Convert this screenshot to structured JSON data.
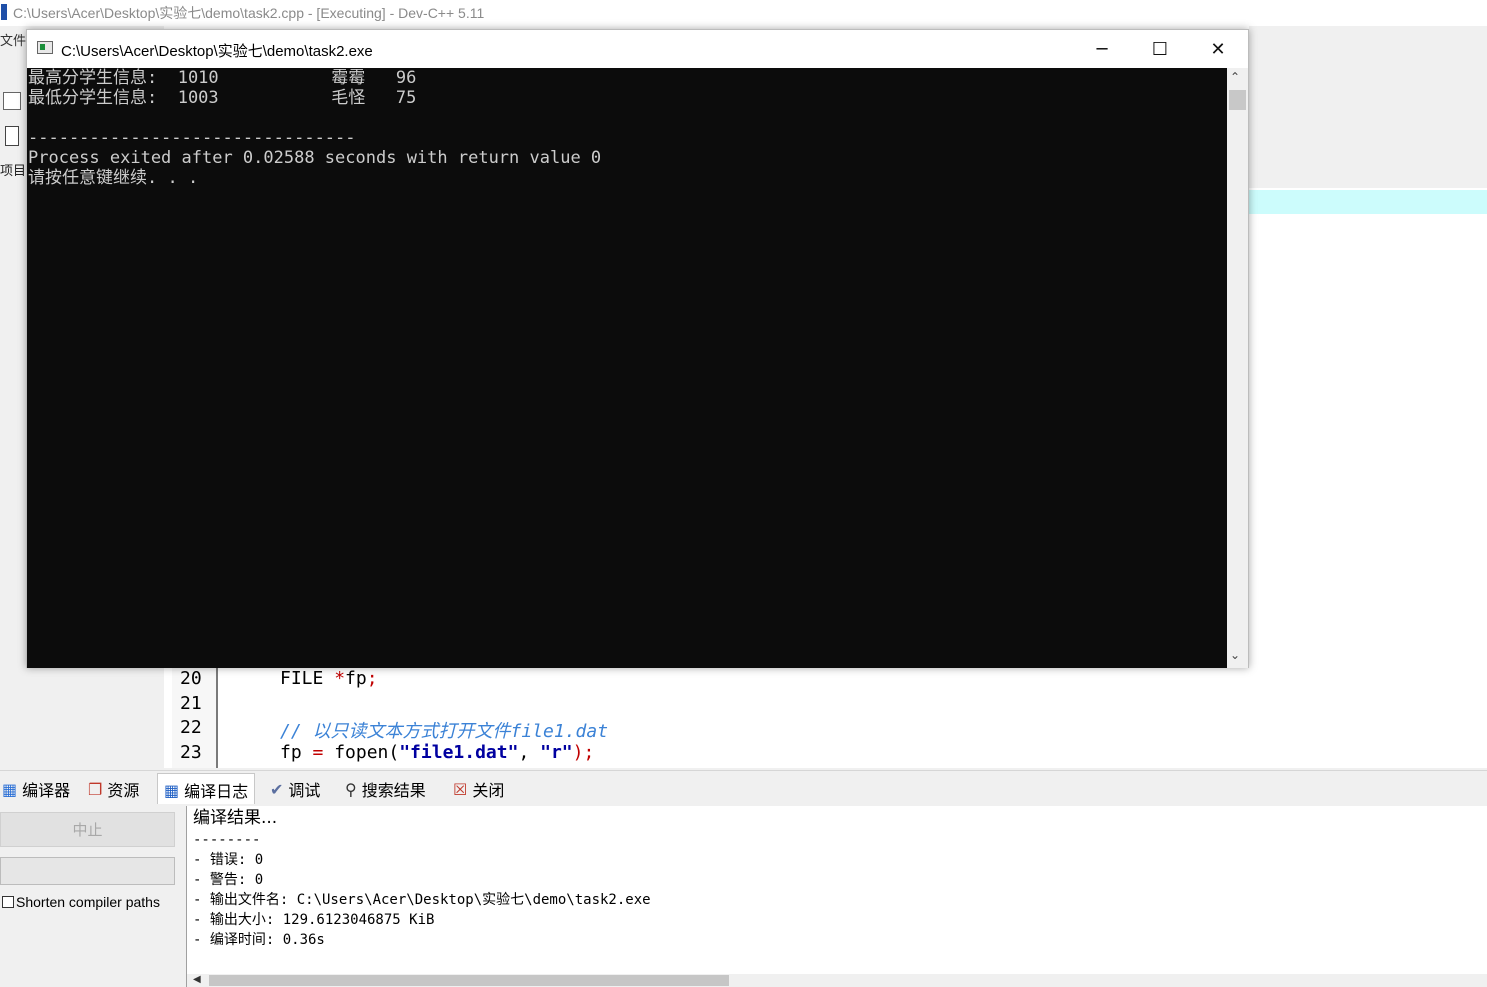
{
  "ide": {
    "title": "C:\\Users\\Acer\\Desktop\\实验七\\demo\\task2.cpp - [Executing] - Dev-C++ 5.11",
    "menu_fragment": "文件",
    "project_tab_fragment": "项目"
  },
  "console": {
    "title": "C:\\Users\\Acer\\Desktop\\实验七\\demo\\task2.exe",
    "controls": {
      "minimize": "─",
      "maximize": "☐",
      "close": "✕"
    },
    "lines": [
      "最高分学生信息:  1010           霉霉   96",
      "最低分学生信息:  1003           毛怪   75",
      "",
      "--------------------------------",
      "Process exited after 0.02588 seconds with return value 0",
      "请按任意键继续. . ."
    ]
  },
  "editor": {
    "lines": [
      {
        "num": "20",
        "pre": "FILE ",
        "op": "*",
        "code": "fp",
        "post": ";"
      },
      {
        "num": "21"
      },
      {
        "num": "22",
        "comment": "// 以只读文本方式打开文件file1.dat"
      },
      {
        "num": "23",
        "pre": "fp ",
        "op": "=",
        "code": " fopen(",
        "str1": "\"file1.dat\"",
        "mid": ", ",
        "str2": "\"r\"",
        "post": ");"
      }
    ]
  },
  "bottom_tabs": [
    {
      "label": "编译器",
      "icon": "grid-icon"
    },
    {
      "label": "资源",
      "icon": "resources-icon"
    },
    {
      "label": "编译日志",
      "icon": "bar-chart-icon"
    },
    {
      "label": "调试",
      "icon": "check-icon"
    },
    {
      "label": "搜索结果",
      "icon": "search-icon"
    },
    {
      "label": "关闭",
      "icon": "close-icon"
    }
  ],
  "compile": {
    "abort_label": "中止",
    "shorten_label": "Shorten compiler paths",
    "log": [
      "编译结果...",
      "--------",
      "- 错误: 0",
      "- 警告: 0",
      "- 输出文件名: C:\\Users\\Acer\\Desktop\\实验七\\demo\\task2.exe",
      "- 输出大小: 129.6123046875 KiB",
      "- 编译时间: 0.36s"
    ]
  }
}
